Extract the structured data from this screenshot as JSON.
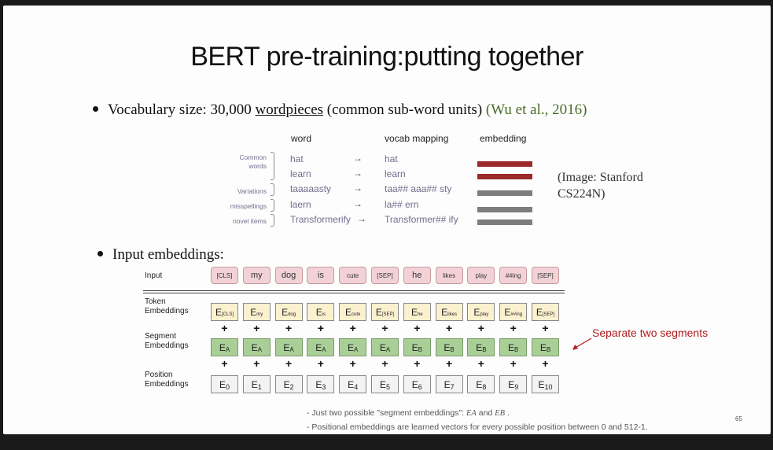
{
  "title": "BERT pre-training:putting together",
  "bullet1": {
    "prefix": "Vocabulary size: 30,000 ",
    "underlined": "wordpieces",
    "middle": " (common sub-word units) ",
    "citation": "(Wu et al., 2016)"
  },
  "vocab_table": {
    "headers": {
      "word": "word",
      "mapping": "vocab mapping",
      "embedding": "embedding"
    },
    "group_labels": {
      "common1": "Common",
      "common2": "words",
      "variations": "Variations",
      "misspellings": "misspellings",
      "novel": "novel items"
    },
    "arrow": "→",
    "rows": [
      {
        "word": "hat",
        "mapping": "hat",
        "color": "#9b2a2a"
      },
      {
        "word": "learn",
        "mapping": "learn",
        "color": "#9b2a2a"
      },
      {
        "word": "taaaaasty",
        "mapping": "taa## aaa## sty",
        "color": "#7d7d7d"
      },
      {
        "word": "laern",
        "mapping": "la## ern",
        "color": "#7d7d7d"
      },
      {
        "word": "Transformerify",
        "mapping": "Transformer## ify",
        "color": "#7d7d7d"
      }
    ]
  },
  "image_credit": {
    "line1": "(Image: Stanford",
    "line2": "CS224N)"
  },
  "bullet2": "Input embeddings:",
  "embedding_figure": {
    "row_labels": {
      "input": "Input",
      "token1": "Token",
      "token2": "Embeddings",
      "segment1": "Segment",
      "segment2": "Embeddings",
      "position1": "Position",
      "position2": "Embeddings"
    },
    "tokens": [
      "[CLS]",
      "my",
      "dog",
      "is",
      "cute",
      "[SEP]",
      "he",
      "likes",
      "play",
      "##ing",
      "[SEP]"
    ],
    "token_embeddings": [
      "[CLS]",
      "my",
      "dog",
      "is",
      "cute",
      "[SEP]",
      "he",
      "likes",
      "play",
      "##ing",
      "[SEP]"
    ],
    "segment_embeddings": [
      "A",
      "A",
      "A",
      "A",
      "A",
      "A",
      "B",
      "B",
      "B",
      "B",
      "B"
    ],
    "position_embeddings": [
      "0",
      "1",
      "2",
      "3",
      "4",
      "5",
      "6",
      "7",
      "8",
      "9",
      "10"
    ],
    "embedding_letter": "E",
    "plus": "+",
    "separate_note": "Separate two segments"
  },
  "notes": {
    "line1_text": "- Just two possible \"segment embeddings\": ",
    "line1_ea": "EA",
    "line1_and": "  and ",
    "line1_eb": "EB",
    "line1_end": " .",
    "line2": "- Positional embeddings are learned vectors for every possible position between 0 and 512-1."
  },
  "page_number": "65"
}
